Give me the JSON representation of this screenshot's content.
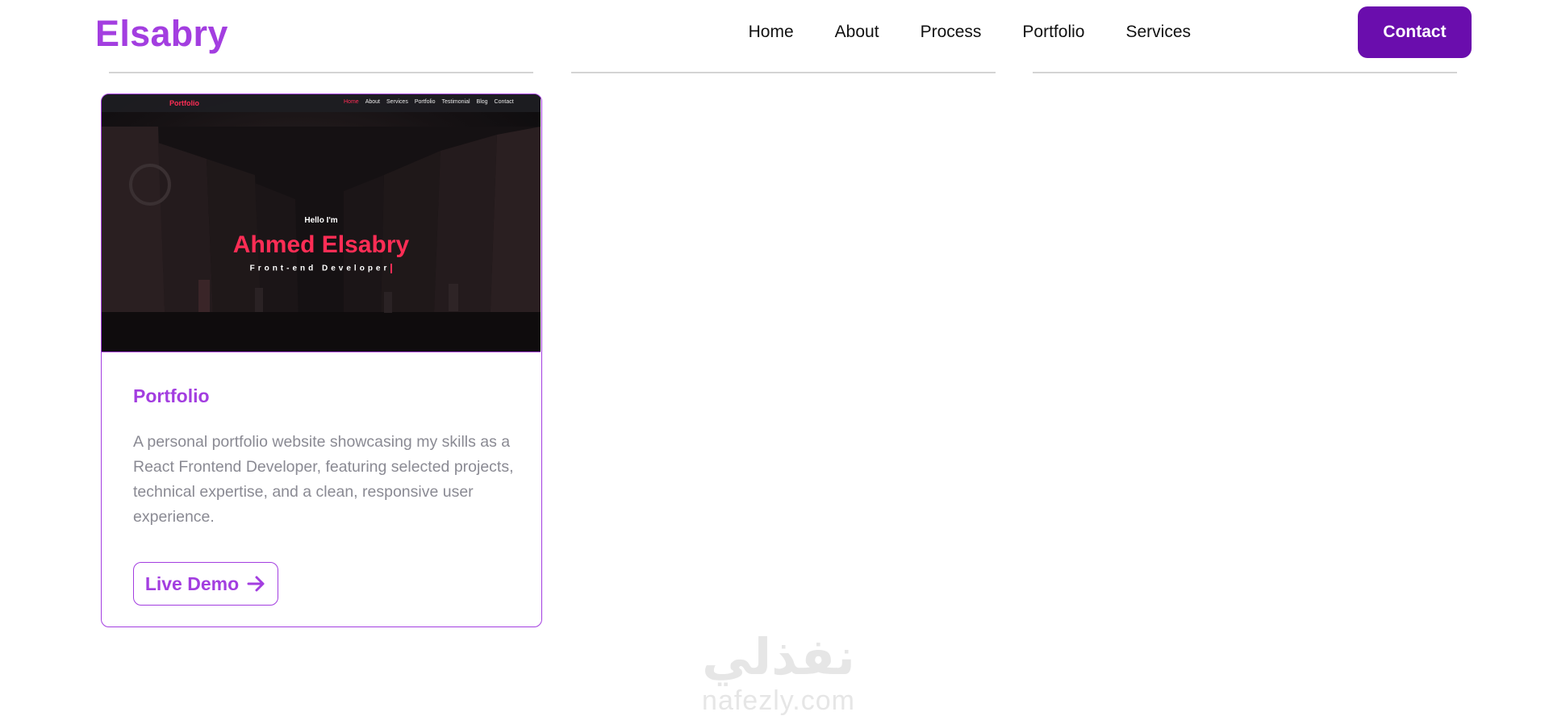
{
  "header": {
    "brand": "Elsabry",
    "nav": [
      "Home",
      "About",
      "Process",
      "Portfolio",
      "Services"
    ],
    "contact_label": "Contact"
  },
  "card": {
    "thumbnail": {
      "mini_brand": "Portfolio",
      "mini_nav": [
        "Home",
        "About",
        "Services",
        "Portfolio",
        "Testimonial",
        "Blog",
        "Contact"
      ],
      "hello": "Hello I'm",
      "name": "Ahmed Elsabry",
      "role": "Front-end Developer"
    },
    "title": "Portfolio",
    "description": "A personal portfolio website showcasing my skills as a React Frontend Developer, featuring selected projects, technical expertise, and a clean, responsive user experience.",
    "button_label": "Live Demo"
  },
  "watermark": {
    "arabic": "نفذلي",
    "latin": "nafezly.com"
  },
  "colors": {
    "brand": "#a33ee0",
    "contact_bg": "#6a0dad",
    "hero_accent": "#ff2d55"
  }
}
